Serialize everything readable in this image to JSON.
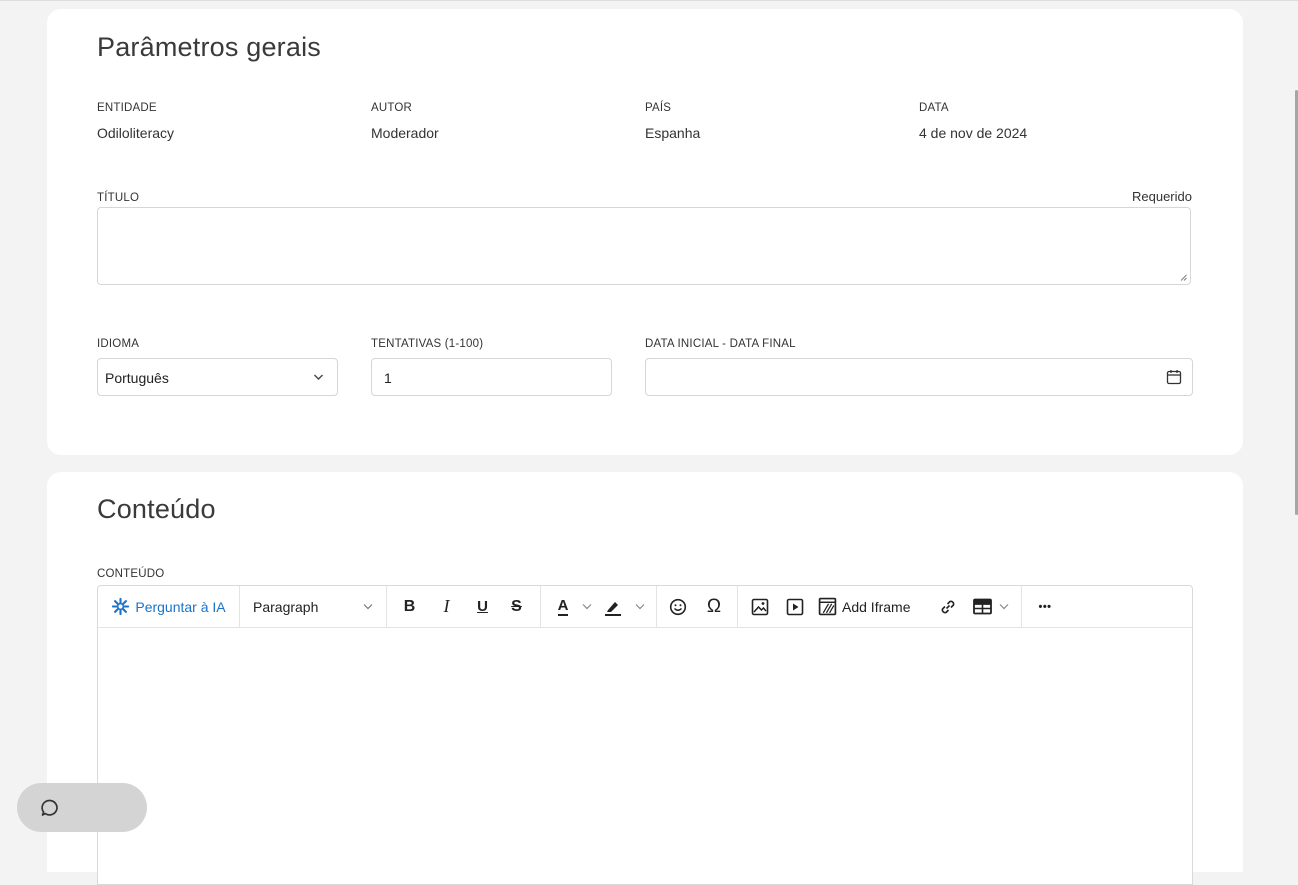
{
  "general": {
    "title": "Parâmetros gerais",
    "meta": [
      {
        "label": "ENTIDADE",
        "value": "Odiloliteracy"
      },
      {
        "label": "AUTOR",
        "value": "Moderador"
      },
      {
        "label": "PAÍS",
        "value": "Espanha"
      },
      {
        "label": "DATA",
        "value": "4 de nov de 2024"
      }
    ],
    "title_field": {
      "label": "TÍTULO",
      "required": "Requerido",
      "value": ""
    },
    "language": {
      "label": "IDIOMA",
      "value": "Português"
    },
    "attempts": {
      "label": "TENTATIVAS (1-100)",
      "value": "1"
    },
    "date_range": {
      "label": "DATA INICIAL - DATA FINAL",
      "value": ""
    }
  },
  "content": {
    "title": "Conteúdo",
    "label": "CONTEÚDO",
    "toolbar": {
      "ask_ai": "Perguntar à IA",
      "block_format": "Paragraph",
      "bold": "B",
      "italic": "I",
      "underline": "U",
      "strikethrough": "S",
      "text_color": "A",
      "special_char": "Ω",
      "add_iframe": "Add Iframe",
      "more": "•••"
    }
  },
  "colors": {
    "accent": "#1a73c9",
    "background": "#f3f3f3",
    "card": "#ffffff",
    "border": "#d6d6d6"
  },
  "icons": [
    "ai-sparkle-icon",
    "chevron-down-icon",
    "calendar-icon",
    "highlight-icon",
    "emoji-icon",
    "image-icon",
    "media-icon",
    "iframe-icon",
    "link-icon",
    "table-icon",
    "chat-icon"
  ]
}
